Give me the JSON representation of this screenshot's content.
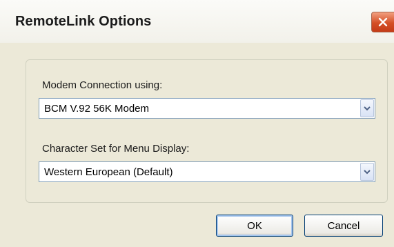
{
  "window": {
    "title": "RemoteLink Options"
  },
  "modem": {
    "label": "Modem Connection using:",
    "selected": "BCM V.92 56K Modem"
  },
  "charset": {
    "label": "Character Set for Menu Display:",
    "selected": "Western European (Default)"
  },
  "buttons": {
    "ok_label": "OK",
    "cancel_label": "Cancel"
  },
  "icons": {
    "close": "close-icon",
    "dropdown": "chevron-down-icon"
  },
  "colors": {
    "close_button": "#d44f26",
    "dialog_background": "#ece9d8",
    "combo_border": "#7f9db9"
  }
}
